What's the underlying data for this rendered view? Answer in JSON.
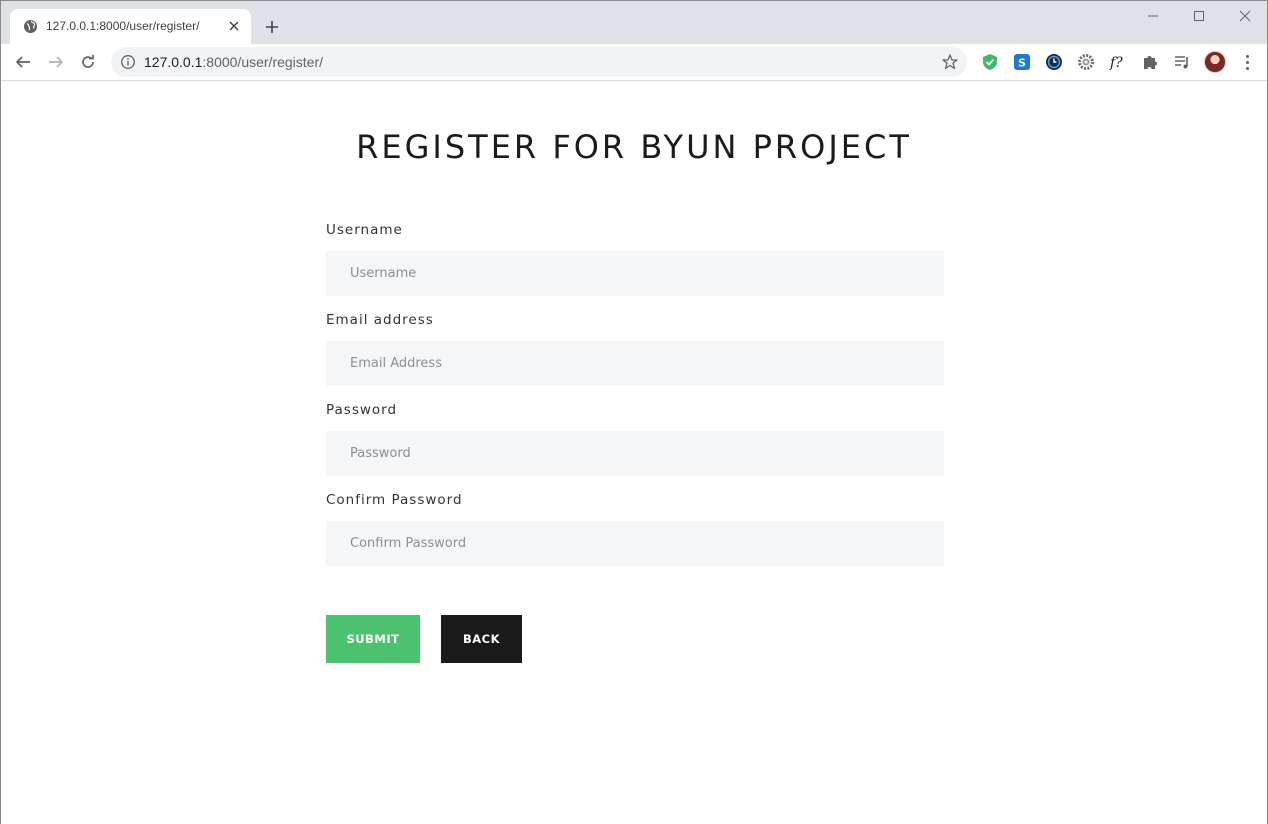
{
  "browser": {
    "tab_title": "127.0.0.1:8000/user/register/",
    "url_host": "127.0.0.1",
    "url_rest": ":8000/user/register/"
  },
  "page": {
    "title": "REGISTER FOR BYUN PROJECT",
    "fields": [
      {
        "label": "Username",
        "placeholder": "Username",
        "value": ""
      },
      {
        "label": "Email address",
        "placeholder": "Email Address",
        "value": ""
      },
      {
        "label": "Password",
        "placeholder": "Password",
        "value": ""
      },
      {
        "label": "Confirm Password",
        "placeholder": "Confirm Password",
        "value": ""
      }
    ],
    "submit_label": "SUBMIT",
    "back_label": "BACK"
  },
  "colors": {
    "submit": "#4cc170",
    "back": "#1b1b1b",
    "input_bg": "#f5f6f7"
  },
  "icons": [
    "globe-icon",
    "close-icon",
    "plus-icon",
    "minimize-icon",
    "maximize-icon",
    "window-close-icon",
    "back-arrow-icon",
    "forward-arrow-icon",
    "reload-icon",
    "info-icon",
    "star-icon",
    "shield-check-icon",
    "skype-icon",
    "clock-icon",
    "gear-icon",
    "font-finder-icon",
    "puzzle-icon",
    "media-control-icon",
    "avatar",
    "menu-dots-icon"
  ]
}
